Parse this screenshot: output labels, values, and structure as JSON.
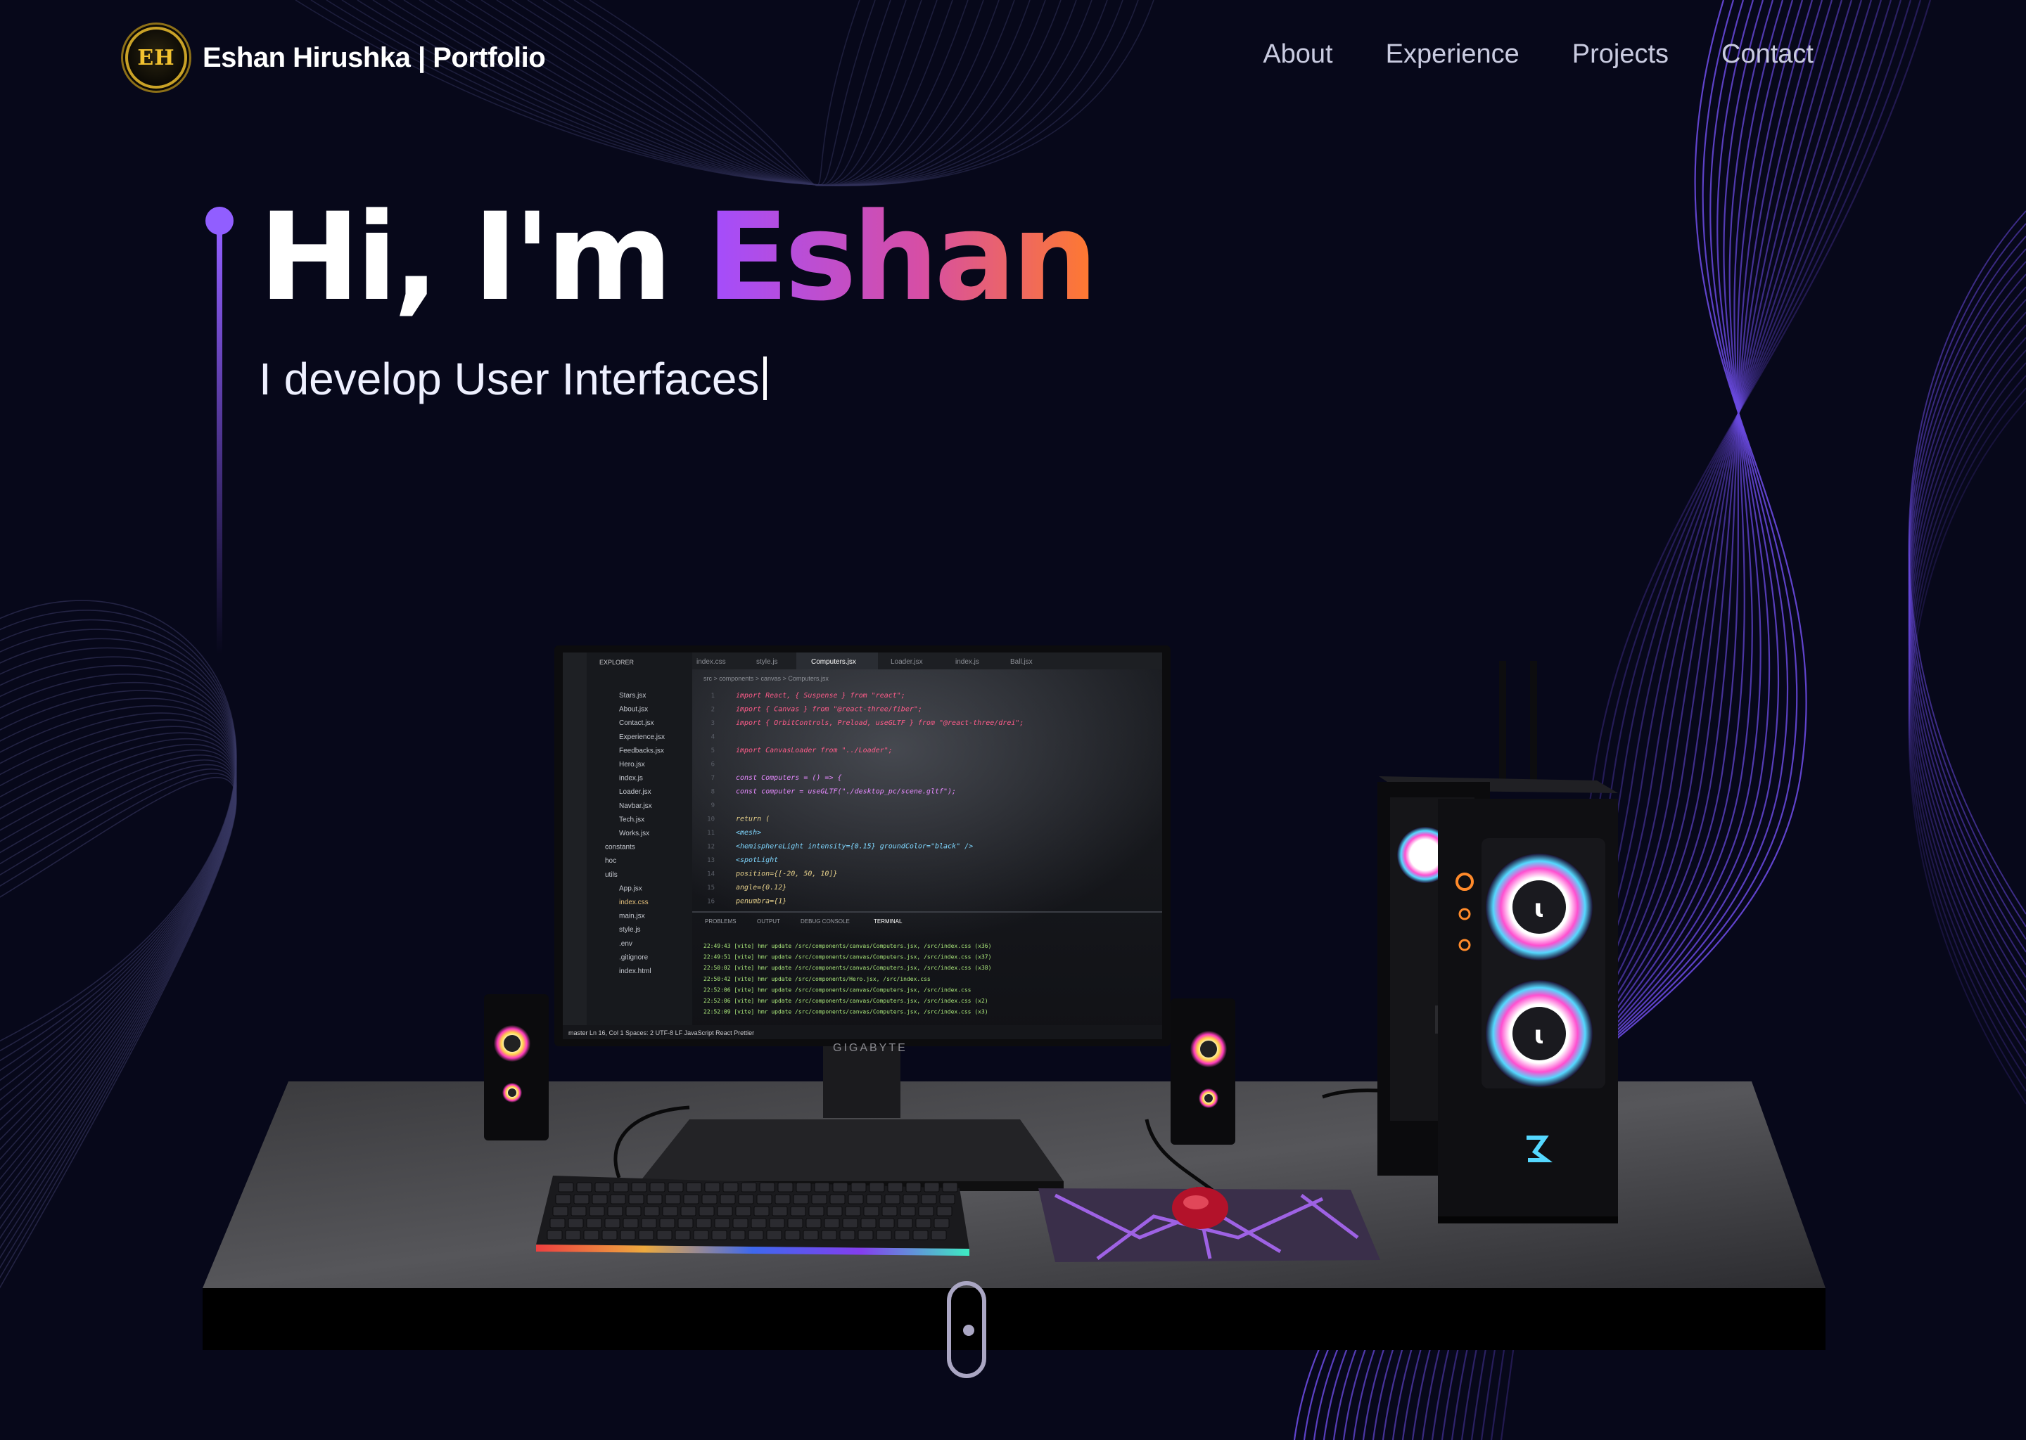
{
  "brand": {
    "logo_text": "EH",
    "name": "Eshan Hirushka | Portfolio"
  },
  "nav": {
    "items": [
      "About",
      "Experience",
      "Projects",
      "Contact"
    ]
  },
  "hero": {
    "greeting": "Hi, I'm ",
    "name": "Eshan",
    "subtitle": "I develop User Interfaces"
  },
  "scene": {
    "monitor_brand": "GIGABYTE",
    "editor": {
      "tabs": [
        "index.css",
        "style.js",
        "Computers.jsx",
        "Loader.jsx",
        "index.js",
        "Ball.jsx"
      ],
      "active_tab": "Computers.jsx",
      "breadcrumb": "src > components > canvas > Computers.jsx",
      "explorer_title": "EXPLORER",
      "files": [
        "Stars.jsx",
        "About.jsx",
        "Contact.jsx",
        "Experience.jsx",
        "Feedbacks.jsx",
        "Hero.jsx",
        "index.js",
        "Loader.jsx",
        "Navbar.jsx",
        "Tech.jsx",
        "Works.jsx",
        "constants",
        "hoc",
        "utils",
        "App.jsx",
        "index.css",
        "main.jsx",
        "style.js",
        ".env",
        ".gitignore",
        "index.html"
      ],
      "code_lines": [
        "import React, { Suspense } from \"react\";",
        "import { Canvas } from \"@react-three/fiber\";",
        "import { OrbitControls, Preload, useGLTF } from \"@react-three/drei\";",
        "",
        "import CanvasLoader from \"../Loader\";",
        "",
        "const Computers = () => {",
        "  const computer = useGLTF(\"./desktop_pc/scene.gltf\");",
        "",
        "  return (",
        "    <mesh>",
        "      <hemisphereLight intensity={0.15} groundColor=\"black\" />",
        "      <spotLight",
        "        position={[-20, 50, 10]}",
        "        angle={0.12}",
        "        penumbra={1}"
      ],
      "panel_tabs": [
        "PROBLEMS",
        "OUTPUT",
        "DEBUG CONSOLE",
        "TERMINAL"
      ],
      "terminal_lines": [
        "22:49:43 [vite] hmr update /src/components/canvas/Computers.jsx, /src/index.css (x36)",
        "22:49:51 [vite] hmr update /src/components/canvas/Computers.jsx, /src/index.css (x37)",
        "22:50:02 [vite] hmr update /src/components/canvas/Computers.jsx, /src/index.css (x38)",
        "22:50:42 [vite] hmr update /src/components/Hero.jsx, /src/index.css",
        "22:52:06 [vite] hmr update /src/components/canvas/Computers.jsx, /src/index.css",
        "22:52:06 [vite] hmr update /src/components/canvas/Computers.jsx, /src/index.css (x2)",
        "22:52:09 [vite] hmr update /src/components/canvas/Computers.jsx, /src/index.css (x3)"
      ],
      "status_bar": "master   Ln 16, Col 1  Spaces: 2  UTF-8  LF  JavaScript React  Prettier"
    }
  },
  "colors": {
    "background": "#07081a",
    "accent": "#915eff",
    "name_gradient": [
      "#a24dff",
      "#d64ea5",
      "#ff7a2e"
    ],
    "nav_text": "#c9cbe0",
    "wave_lines": "#6a4ae0",
    "rgb_glow": [
      "#ff3cbe",
      "#52e0ff",
      "#ffe45c"
    ]
  },
  "icons": [
    "logo-emblem-icon",
    "scroll-mouse-icon"
  ]
}
